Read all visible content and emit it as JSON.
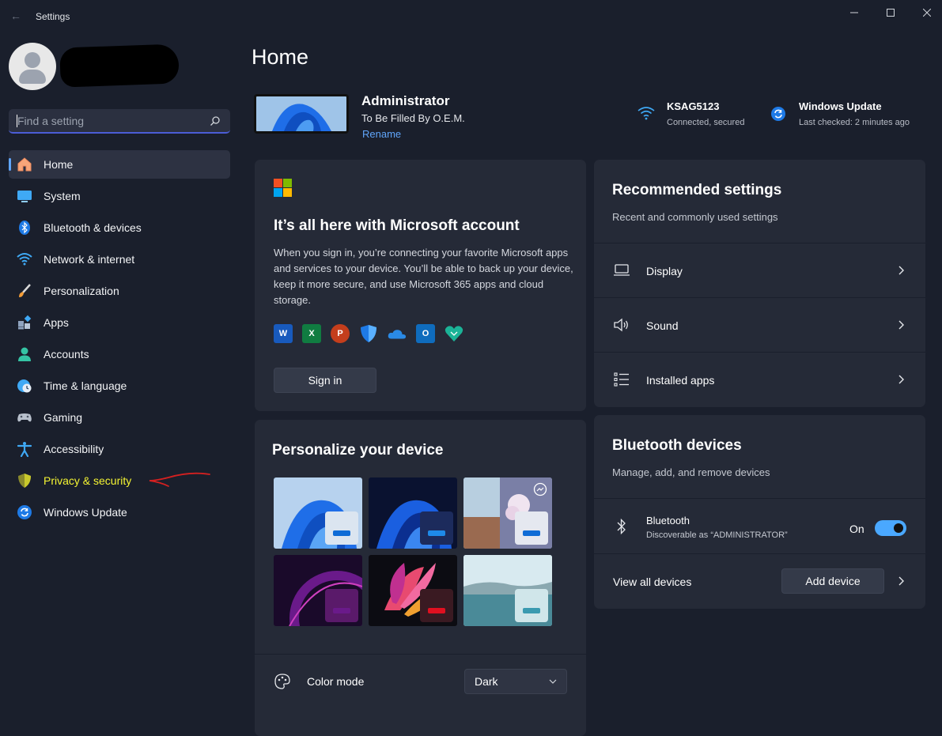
{
  "window": {
    "title": "Settings"
  },
  "search": {
    "placeholder": "Find a setting"
  },
  "sidebar": {
    "items": [
      {
        "label": "Home",
        "icon": "home-icon",
        "active": true
      },
      {
        "label": "System",
        "icon": "system-icon"
      },
      {
        "label": "Bluetooth & devices",
        "icon": "bluetooth-icon"
      },
      {
        "label": "Network & internet",
        "icon": "wifi-icon"
      },
      {
        "label": "Personalization",
        "icon": "paintbrush-icon"
      },
      {
        "label": "Apps",
        "icon": "apps-icon"
      },
      {
        "label": "Accounts",
        "icon": "person-icon"
      },
      {
        "label": "Time & language",
        "icon": "globe-clock-icon"
      },
      {
        "label": "Gaming",
        "icon": "gamepad-icon"
      },
      {
        "label": "Accessibility",
        "icon": "accessibility-icon"
      },
      {
        "label": "Privacy & security",
        "icon": "shield-icon",
        "highlighted": true,
        "highlight_color": "#f5f532"
      },
      {
        "label": "Windows Update",
        "icon": "windows-update-icon"
      }
    ]
  },
  "header": {
    "title": "Home",
    "device": {
      "name": "Administrator",
      "description": "To Be Filled By O.E.M.",
      "rename_label": "Rename"
    },
    "status": {
      "network": {
        "name": "KSAG5123",
        "detail": "Connected, secured"
      },
      "update": {
        "name": "Windows Update",
        "detail": "Last checked: 2 minutes ago"
      }
    }
  },
  "microsoft_account": {
    "title": "It’s all here with Microsoft account",
    "body": "When you sign in, you’re connecting your favorite Microsoft apps and services to your device. You’ll be able to back up your device, keep it more secure, and use Microsoft 365 apps and cloud storage.",
    "apps": [
      "word-icon",
      "excel-icon",
      "powerpoint-icon",
      "defender-icon",
      "onedrive-icon",
      "outlook-icon",
      "family-icon"
    ],
    "signin_label": "Sign in"
  },
  "personalize": {
    "title": "Personalize your device",
    "color_mode_label": "Color mode",
    "color_mode_value": "Dark"
  },
  "recommended": {
    "title": "Recommended settings",
    "subtitle": "Recent and commonly used settings",
    "items": [
      {
        "label": "Display",
        "icon": "laptop-icon"
      },
      {
        "label": "Sound",
        "icon": "speaker-icon"
      },
      {
        "label": "Installed apps",
        "icon": "list-icon"
      }
    ]
  },
  "bluetooth": {
    "title": "Bluetooth devices",
    "subtitle": "Manage, add, and remove devices",
    "row_label": "Bluetooth",
    "row_detail": "Discoverable as “ADMINISTRATOR”",
    "state_label": "On",
    "toggle_on": true,
    "view_all_label": "View all devices",
    "add_label": "Add device"
  },
  "colors": {
    "accent": "#4aa8ff",
    "background": "#1a1f2c",
    "card": "#252a37",
    "annotation": "#d42020"
  }
}
